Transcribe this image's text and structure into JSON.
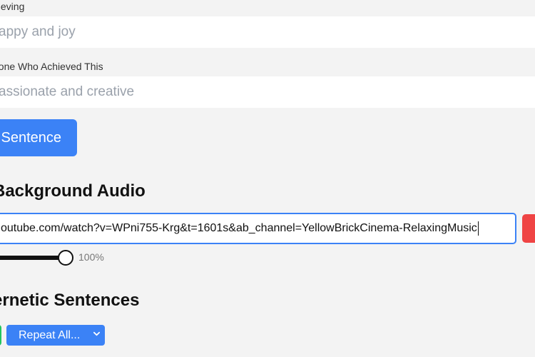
{
  "achieving": {
    "label": "hieving",
    "placeholder": "appy and joy"
  },
  "someone": {
    "label": "eone Who Achieved This",
    "placeholder": "assionate and creative"
  },
  "sentence_button": "Sentence",
  "background_audio": {
    "heading": "Background Audio",
    "url_value": "outube.com/watch?v=WPni755-Krg&t=1601s&ab_channel=YellowBrickCinema-RelaxingMusic",
    "volume_label": "100%",
    "volume_level": 1.0
  },
  "cybernetic": {
    "heading": "ernetic Sentences",
    "repeat_option": "Repeat All..."
  },
  "colors": {
    "accent": "#3b82f6",
    "danger": "#ef4444",
    "success": "#22c55e"
  }
}
